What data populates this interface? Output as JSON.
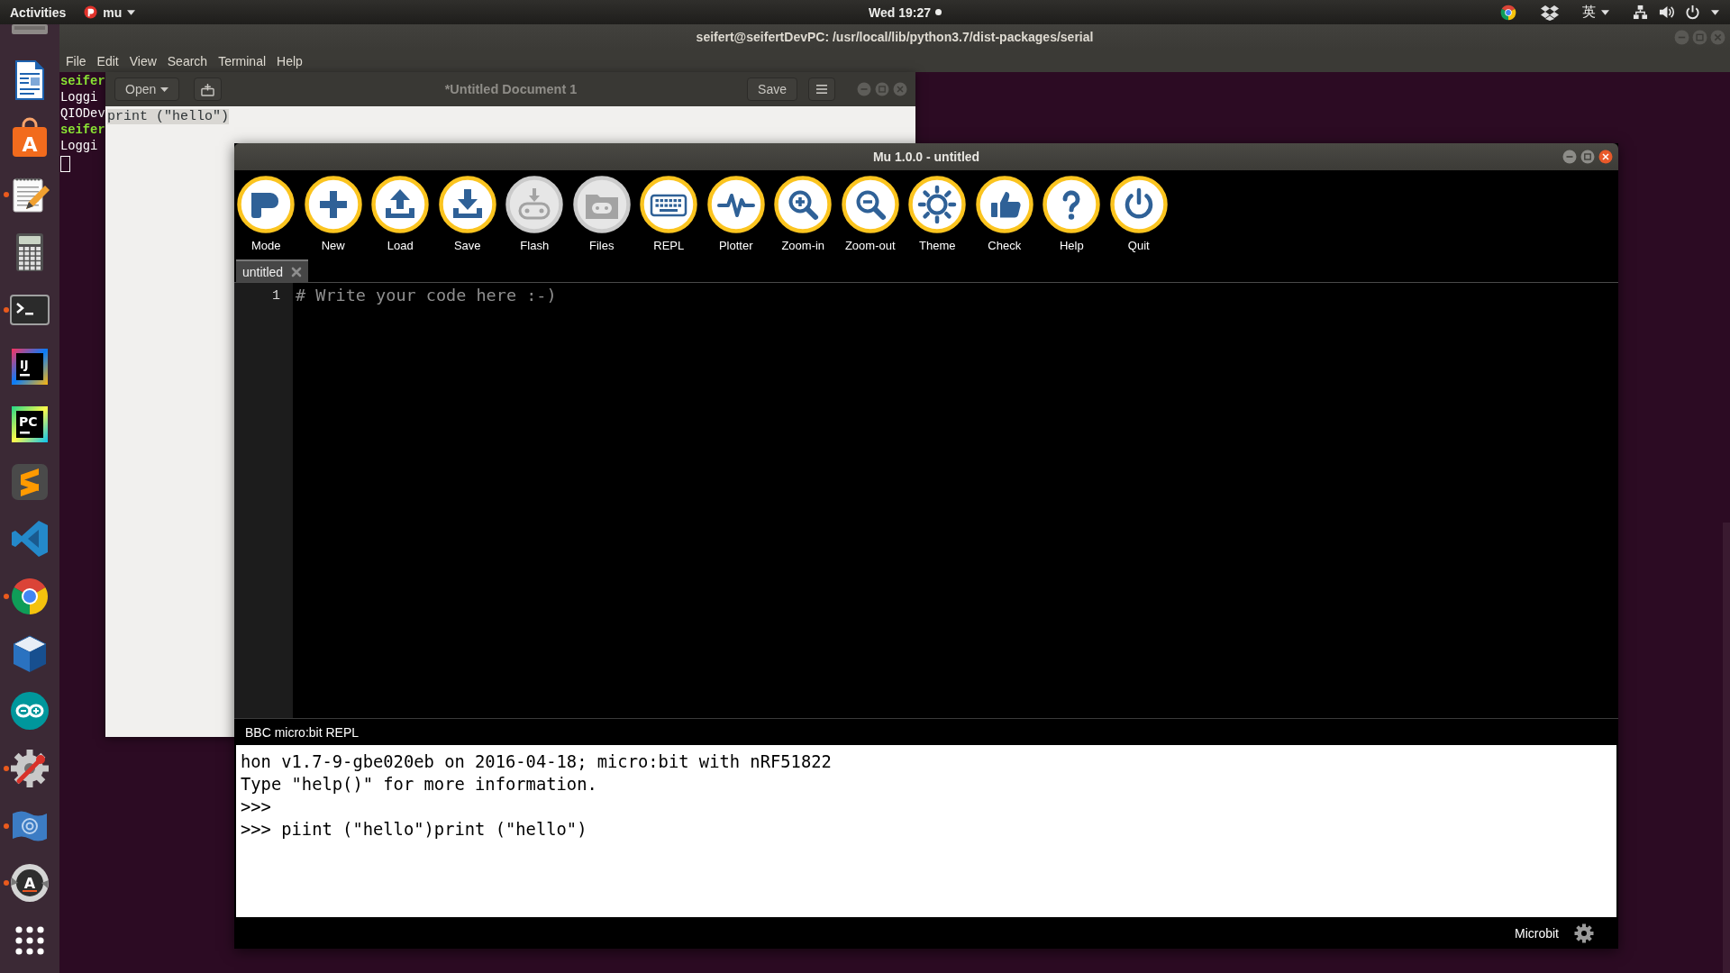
{
  "top_bar": {
    "activities": "Activities",
    "app_menu": "mu",
    "clock": "Wed 19:27",
    "notification": true,
    "input_method": "英"
  },
  "dock": [
    {
      "kind": "drive",
      "running": false
    },
    {
      "kind": "writer",
      "running": false
    },
    {
      "kind": "software",
      "text": "A",
      "running": false
    },
    {
      "kind": "text_editor",
      "running": true
    },
    {
      "kind": "calculator",
      "running": false
    },
    {
      "kind": "terminal",
      "running": true
    },
    {
      "kind": "ij",
      "text": "IJ",
      "running": false
    },
    {
      "kind": "pc",
      "text": "PC",
      "running": false
    },
    {
      "kind": "sublime",
      "running": false
    },
    {
      "kind": "vscode",
      "running": false
    },
    {
      "kind": "browser",
      "running": true
    },
    {
      "kind": "virtualbox",
      "running": false
    },
    {
      "kind": "arduino",
      "running": false
    },
    {
      "kind": "tools",
      "running": true
    },
    {
      "kind": "flag",
      "running": true
    },
    {
      "kind": "updater",
      "text": "A",
      "running": true
    },
    {
      "kind": "apps",
      "running": false
    }
  ],
  "terminal": {
    "title": "seifert@seifertDevPC: /usr/local/lib/python3.7/dist-packages/serial",
    "menu": [
      "File",
      "Edit",
      "View",
      "Search",
      "Terminal",
      "Help"
    ],
    "lines": [
      {
        "kind": "prompt",
        "text": "seifer"
      },
      {
        "kind": "output",
        "text": "Loggi"
      },
      {
        "kind": "output",
        "text": "QIODev"
      },
      {
        "kind": "prompt",
        "text": "seifer"
      },
      {
        "kind": "output",
        "text": "Loggi"
      }
    ]
  },
  "gedit": {
    "open": "Open",
    "title": "*Untitled Document 1",
    "save": "Save",
    "text": "print (\"hello\")"
  },
  "mu": {
    "title": "Mu 1.0.0 - untitled",
    "toolbar": [
      {
        "kind": "mode",
        "label": "Mode",
        "disabled": false
      },
      {
        "kind": "new",
        "label": "New",
        "disabled": false
      },
      {
        "kind": "load",
        "label": "Load",
        "disabled": false
      },
      {
        "kind": "save",
        "label": "Save",
        "disabled": false
      },
      {
        "kind": "flash",
        "label": "Flash",
        "disabled": true
      },
      {
        "kind": "files",
        "label": "Files",
        "disabled": true
      },
      {
        "kind": "repl",
        "label": "REPL",
        "disabled": false
      },
      {
        "kind": "plotter",
        "label": "Plotter",
        "disabled": false
      },
      {
        "kind": "zoom-in",
        "label": "Zoom-in",
        "disabled": false
      },
      {
        "kind": "zoom-out",
        "label": "Zoom-out",
        "disabled": false
      },
      {
        "kind": "theme",
        "label": "Theme",
        "disabled": false
      },
      {
        "kind": "check",
        "label": "Check",
        "disabled": false
      },
      {
        "kind": "help",
        "label": "Help",
        "disabled": false
      },
      {
        "kind": "quit",
        "label": "Quit",
        "disabled": false
      }
    ],
    "tabs": [
      {
        "label": "untitled",
        "selected": true
      }
    ],
    "editor": {
      "lines": [
        {
          "number": "1",
          "code": "# Write your code here :-)"
        }
      ]
    },
    "repl": {
      "title": "BBC micro:bit REPL",
      "lines": [
        "hon v1.7-9-gbe020eb on 2016-04-18; micro:bit with nRF51822",
        "Type \"help()\" for more information.",
        ">>>",
        ">>> piint (\"hello\")print (\"hello\")"
      ]
    },
    "status_bar": {
      "mode": "Microbit"
    }
  }
}
